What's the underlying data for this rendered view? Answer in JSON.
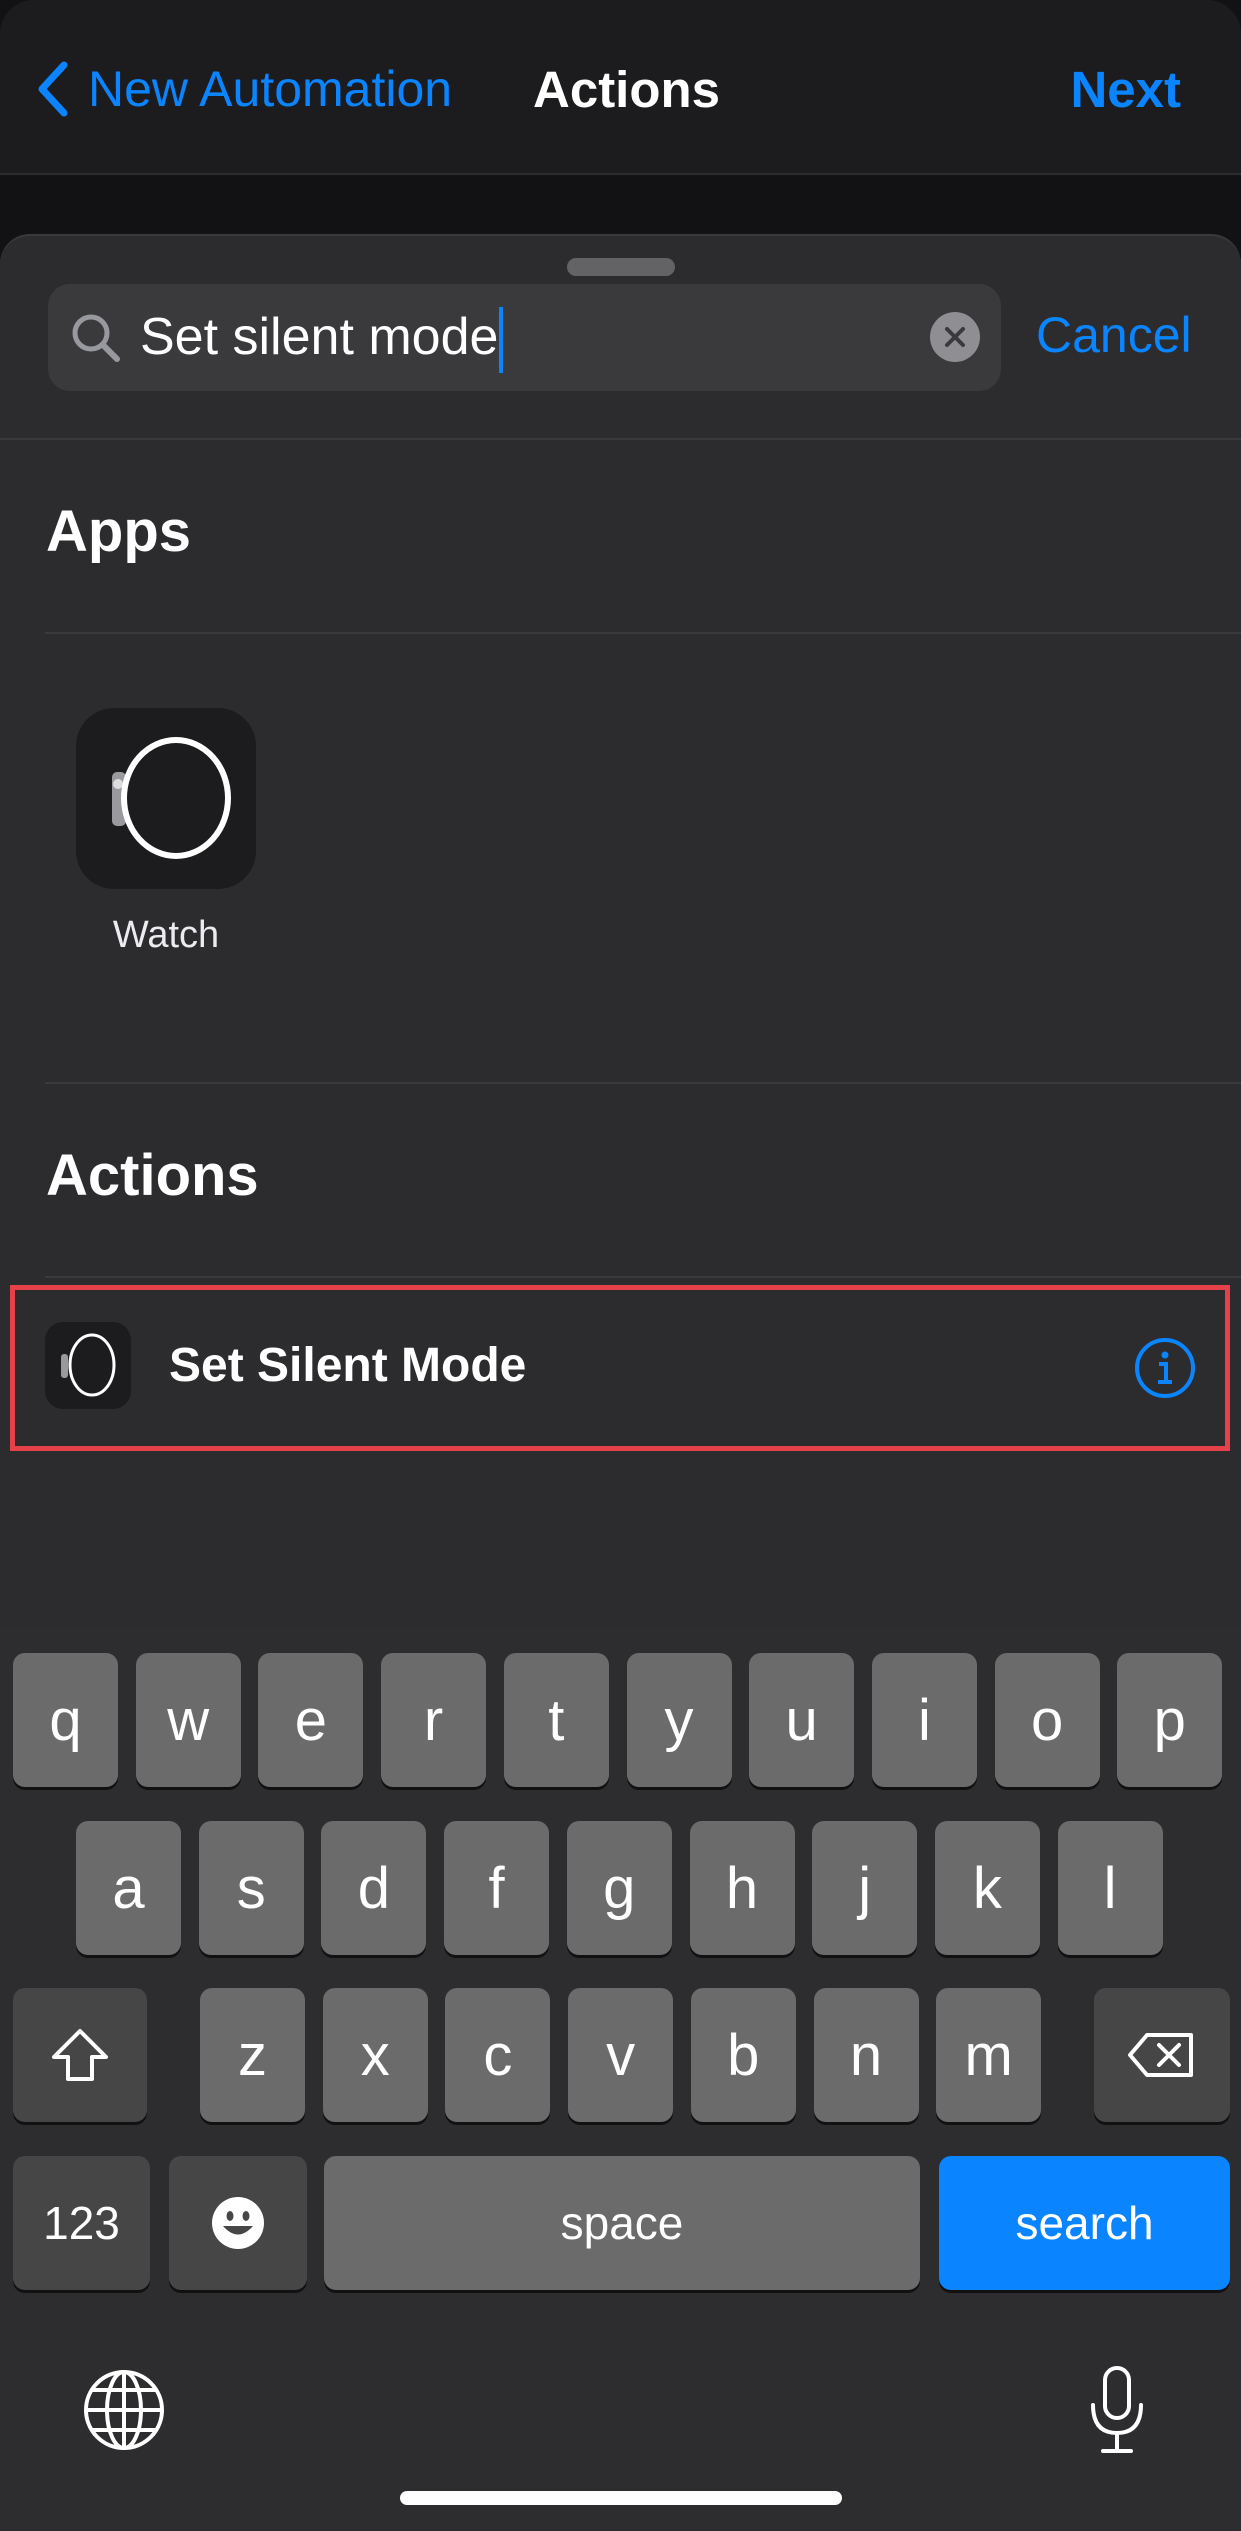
{
  "nav": {
    "back_label": "New Automation",
    "title": "Actions",
    "next_label": "Next"
  },
  "search": {
    "value": "Set silent mode",
    "cancel_label": "Cancel"
  },
  "apps": {
    "header": "Apps",
    "items": [
      {
        "label": "Watch",
        "icon": "watch-icon"
      }
    ]
  },
  "actions": {
    "header": "Actions",
    "items": [
      {
        "label": "Set Silent Mode",
        "icon": "watch-icon",
        "info": "info-icon"
      }
    ]
  },
  "highlight_color": "#e5414b",
  "accent_color": "#0a84ff",
  "keyboard": {
    "row1": [
      "q",
      "w",
      "e",
      "r",
      "t",
      "y",
      "u",
      "i",
      "o",
      "p"
    ],
    "row2": [
      "a",
      "s",
      "d",
      "f",
      "g",
      "h",
      "j",
      "k",
      "l"
    ],
    "row3": [
      "z",
      "x",
      "c",
      "v",
      "b",
      "n",
      "m"
    ],
    "numbers_label": "123",
    "space_label": "space",
    "search_label": "search"
  }
}
